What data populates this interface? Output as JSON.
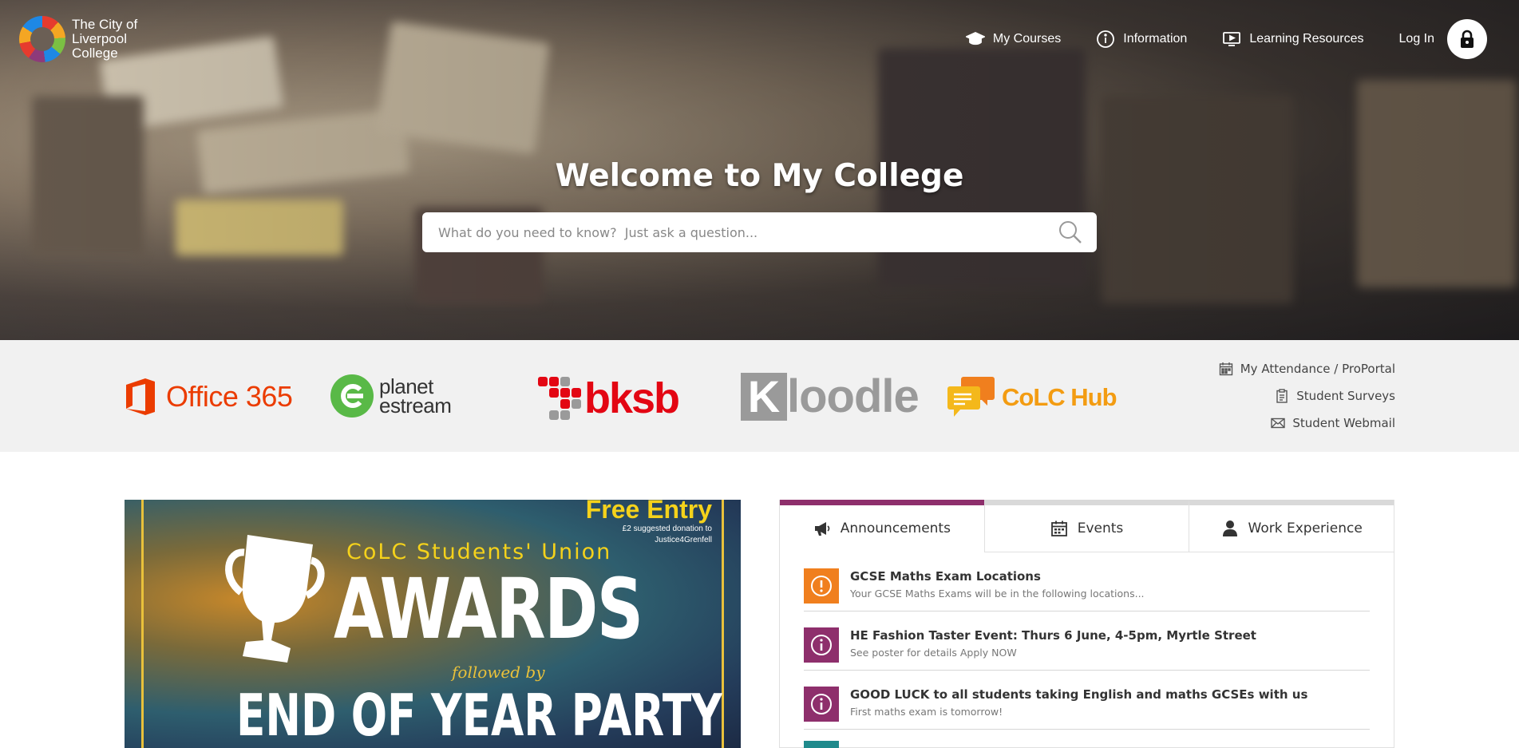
{
  "header": {
    "logo_text": "The City of Liverpool College",
    "nav": [
      {
        "label": "My Courses",
        "icon": "graduation-cap-icon"
      },
      {
        "label": "Information",
        "icon": "info-circle-icon"
      },
      {
        "label": "Learning Resources",
        "icon": "monitor-play-icon"
      }
    ],
    "login_label": "Log In",
    "login_icon": "lock-icon"
  },
  "hero": {
    "title": "Welcome to My College",
    "search_placeholder": "What do you need to know?  Just ask a question..."
  },
  "quicklinks": {
    "office365": "Office 365",
    "planet_line1": "planet",
    "planet_line2": "estream",
    "bksb": "bksb",
    "kloodle_k": "K",
    "kloodle_rest": "loodle",
    "colc_hub": "CoLC Hub",
    "side_links": [
      {
        "label": "My Attendance / ProPortal",
        "icon": "calendar-icon"
      },
      {
        "label": "Student Surveys",
        "icon": "clipboard-icon"
      },
      {
        "label": "Student Webmail",
        "icon": "envelope-icon"
      }
    ]
  },
  "poster": {
    "free_entry": "Free Entry",
    "donation": "£2 suggested donation to Justice4Grenfell",
    "su_line": "CoLC Students' Union",
    "awards": "AWARDS",
    "followed_by": "followed by",
    "party": "END OF YEAR PARTY"
  },
  "tabs": [
    {
      "label": "Announcements",
      "icon": "megaphone-icon",
      "active": true
    },
    {
      "label": "Events",
      "icon": "calendar-icon",
      "active": false
    },
    {
      "label": "Work Experience",
      "icon": "user-icon",
      "active": false
    }
  ],
  "announcements": [
    {
      "title": "GCSE Maths Exam Locations",
      "subtitle": "Your GCSE Maths Exams will be in the following locations...",
      "icon": "exclamation-icon",
      "color": "#f07f1e"
    },
    {
      "title": "HE Fashion Taster Event: Thurs 6 June, 4-5pm, Myrtle Street",
      "subtitle": "See poster for details Apply NOW",
      "icon": "info-icon",
      "color": "#8e2f6c"
    },
    {
      "title": "GOOD LUCK to all students taking English and maths GCSEs with us",
      "subtitle": "First maths exam is tomorrow!",
      "icon": "info-icon",
      "color": "#8e2f6c"
    }
  ],
  "colors": {
    "accent_purple": "#8e2f6c",
    "accent_orange": "#f07f1e",
    "office_red": "#eb3c00",
    "bksb_red": "#e30613",
    "colc_orange": "#f39c12"
  }
}
